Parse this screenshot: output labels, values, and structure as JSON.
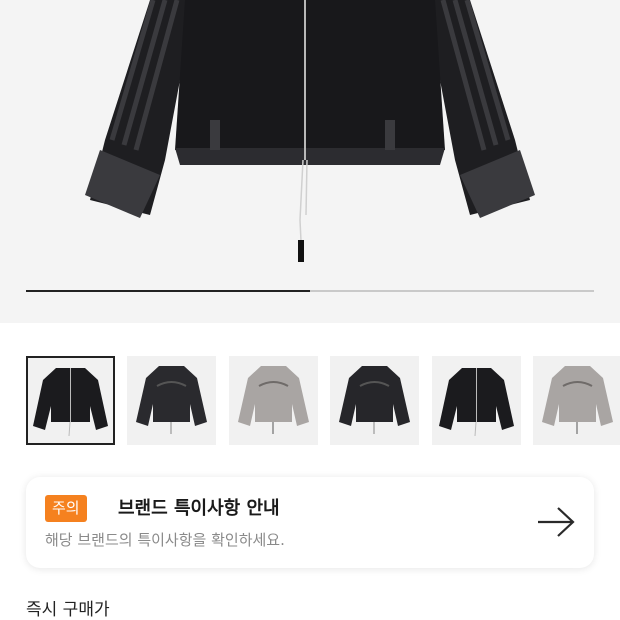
{
  "gallery": {
    "current_slide_fraction": 0.5,
    "thumbnails": [
      {
        "icon": "jacket-velour-black-front-icon",
        "selected": true
      },
      {
        "icon": "jacket-black-back-icon",
        "selected": false
      },
      {
        "icon": "jacket-grey-back-icon",
        "selected": false
      },
      {
        "icon": "jacket-black-back-icon",
        "selected": false
      },
      {
        "icon": "jacket-velour-black-front-icon",
        "selected": false
      },
      {
        "icon": "jacket-grey-back-icon",
        "selected": false
      }
    ]
  },
  "notice": {
    "badge": "주의",
    "title": "브랜드 특이사항 안내",
    "description": "해당 브랜드의 특이사항을 확인하세요.",
    "icon": "arrow-right-icon",
    "badge_color": "#f5811f"
  },
  "price": {
    "label": "즉시 구매가"
  }
}
